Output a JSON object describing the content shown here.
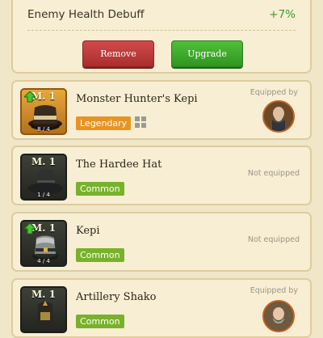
{
  "stat": {
    "label": "Enemy Health Debuff",
    "value": "+7%"
  },
  "buttons": {
    "remove": "Remove",
    "upgrade": "Upgrade"
  },
  "equipped_by_label": "Equipped by",
  "not_equipped_label": "Not equipped",
  "items": [
    {
      "level": "M. 1",
      "name": "Monster Hunter's Kepi",
      "rarity": "Legendary",
      "count": "8 / 4",
      "upgradable": true,
      "equipped": true,
      "status": "Equipped by"
    },
    {
      "level": "M. 1",
      "name": "The Hardee Hat",
      "rarity": "Common",
      "count": "1 / 4",
      "upgradable": false,
      "equipped": false,
      "status": "Not equipped"
    },
    {
      "level": "M. 1",
      "name": "Kepi",
      "rarity": "Common",
      "count": "4 / 4",
      "upgradable": true,
      "equipped": false,
      "status": "Not equipped"
    },
    {
      "level": "M. 1",
      "name": "Artillery Shako",
      "rarity": "Common",
      "count": "",
      "upgradable": false,
      "equipped": true,
      "status": "Equipped by"
    }
  ],
  "colors": {
    "legendary": "#e89424",
    "common": "#78b22a",
    "positive": "#3e9a2c",
    "remove": "#b83636",
    "upgrade": "#3aa82a"
  }
}
